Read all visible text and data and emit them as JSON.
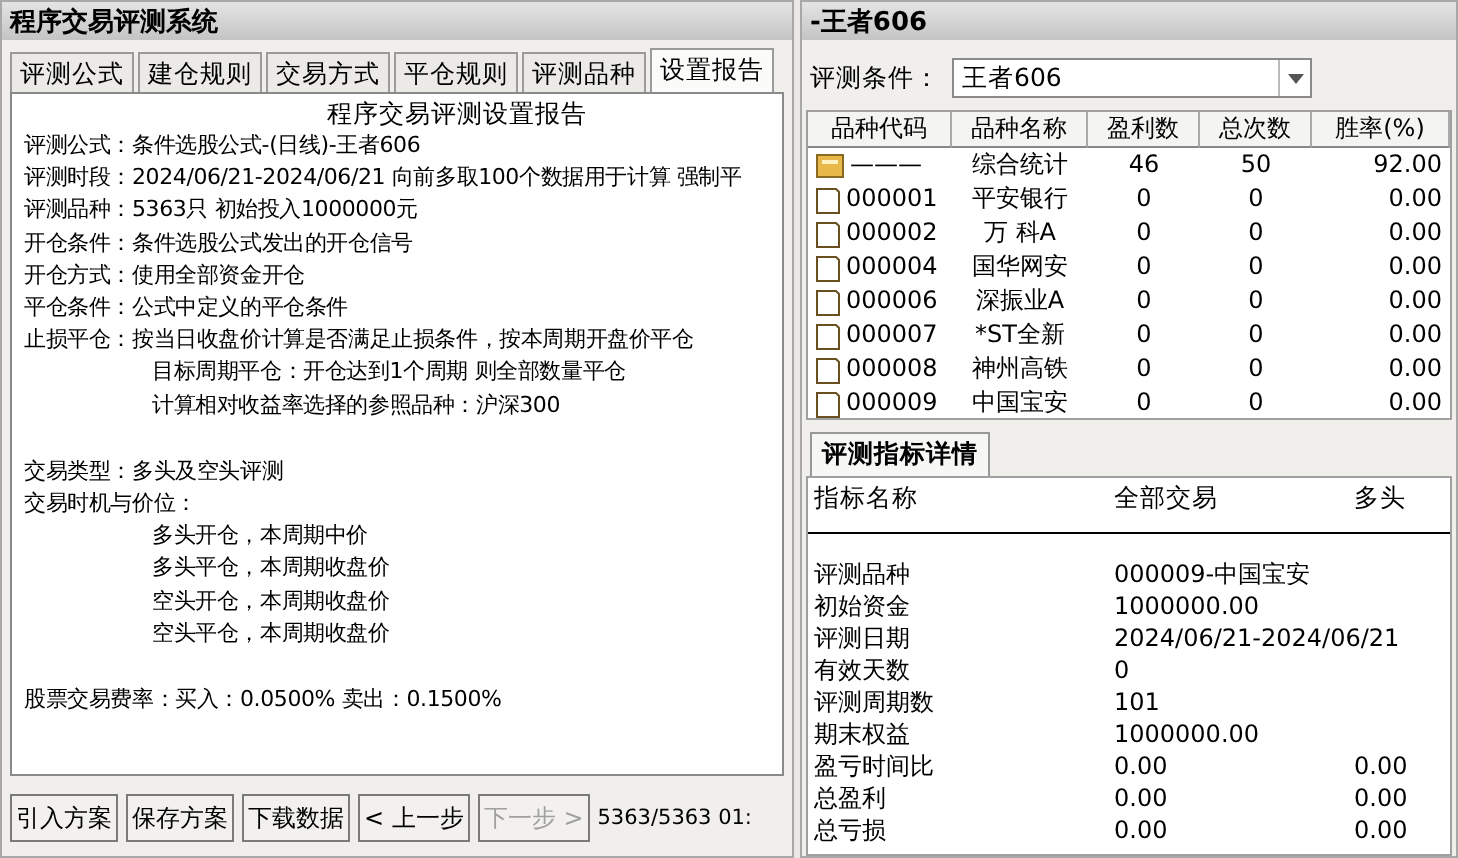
{
  "left": {
    "title": "程序交易评测系统",
    "tabs": [
      {
        "label": "评测公式",
        "selected": false
      },
      {
        "label": "建仓规则",
        "selected": false
      },
      {
        "label": "交易方式",
        "selected": false
      },
      {
        "label": "平仓规则",
        "selected": false
      },
      {
        "label": "评测品种",
        "selected": false
      },
      {
        "label": "设置报告",
        "selected": true
      }
    ],
    "report": {
      "heading": "程序交易评测设置报告",
      "sections": [
        [
          {
            "kind": "line",
            "text": "评测公式：条件选股公式-(日线)-王者606"
          },
          {
            "kind": "line",
            "text": "评测时段：2024/06/21-2024/06/21 向前多取100个数据用于计算 强制平"
          },
          {
            "kind": "line",
            "text": "评测品种：5363只 初始投入1000000元"
          },
          {
            "kind": "line",
            "text": "开仓条件：条件选股公式发出的开仓信号"
          },
          {
            "kind": "line",
            "text": "开仓方式：使用全部资金开仓"
          },
          {
            "kind": "line",
            "text": "平仓条件：公式中定义的平仓条件"
          },
          {
            "kind": "line",
            "text": "止损平仓：按当日收盘价计算是否满足止损条件，按本周期开盘价平仓"
          },
          {
            "kind": "indent",
            "text": "目标周期平仓：开仓达到1个周期 则全部数量平仓"
          },
          {
            "kind": "indent",
            "text": "计算相对收益率选择的参照品种：沪深300"
          }
        ],
        [
          {
            "kind": "line",
            "text": "交易类型：多头及空头评测"
          },
          {
            "kind": "line",
            "text": "交易时机与价位："
          },
          {
            "kind": "indent",
            "text": "多头开仓，本周期中价"
          },
          {
            "kind": "indent",
            "text": "多头平仓，本周期收盘价"
          },
          {
            "kind": "indent",
            "text": "空头开仓，本周期收盘价"
          },
          {
            "kind": "indent",
            "text": "空头平仓，本周期收盘价"
          }
        ],
        [
          {
            "kind": "line",
            "text": "股票交易费率：买入：0.0500%  卖出：0.1500%"
          }
        ]
      ]
    },
    "buttons": [
      {
        "label": "引入方案",
        "disabled": false
      },
      {
        "label": "保存方案",
        "disabled": false
      },
      {
        "label": "下载数据",
        "disabled": false
      },
      {
        "label": "< 上一步",
        "disabled": false
      },
      {
        "label": "下一步 >",
        "disabled": true
      }
    ],
    "status": "5363/5363 01:"
  },
  "right": {
    "title": "-王者606",
    "condition": {
      "label": "评测条件：",
      "value": "王者606"
    },
    "table": {
      "columns": [
        "品种代码",
        "品种名称",
        "盈利数",
        "总次数",
        "胜率(%)"
      ],
      "rows": [
        {
          "kind": "summary",
          "code": "———",
          "name": "综合统计",
          "profit": "46",
          "total": "50",
          "rate": "92.00"
        },
        {
          "kind": "stock",
          "code": "000001",
          "name": "平安银行",
          "profit": "0",
          "total": "0",
          "rate": "0.00"
        },
        {
          "kind": "stock",
          "code": "000002",
          "name": "万 科A",
          "profit": "0",
          "total": "0",
          "rate": "0.00"
        },
        {
          "kind": "stock",
          "code": "000004",
          "name": "国华网安",
          "profit": "0",
          "total": "0",
          "rate": "0.00"
        },
        {
          "kind": "stock",
          "code": "000006",
          "name": "深振业A",
          "profit": "0",
          "total": "0",
          "rate": "0.00"
        },
        {
          "kind": "stock",
          "code": "000007",
          "name": "*ST全新",
          "profit": "0",
          "total": "0",
          "rate": "0.00"
        },
        {
          "kind": "stock",
          "code": "000008",
          "name": "神州高铁",
          "profit": "0",
          "total": "0",
          "rate": "0.00"
        },
        {
          "kind": "stock",
          "code": "000009",
          "name": "中国宝安",
          "profit": "0",
          "total": "0",
          "rate": "0.00"
        }
      ]
    },
    "detail": {
      "tab": "评测指标详情",
      "columns": [
        "指标名称",
        "全部交易",
        "多头"
      ],
      "rows": [
        [
          "评测品种",
          "000009-中国宝安"
        ],
        [
          "初始资金",
          "1000000.00"
        ],
        [
          "评测日期",
          "2024/06/21-2024/06/21"
        ],
        [
          "有效天数",
          "0"
        ],
        [
          "评测周期数",
          "101"
        ],
        [
          "期末权益",
          "1000000.00"
        ],
        [
          "盈亏时间比",
          "0.00",
          "0.00"
        ],
        [
          "总盈利",
          "0.00",
          "0.00"
        ],
        [
          "总亏损",
          "0.00",
          "0.00"
        ]
      ]
    }
  }
}
